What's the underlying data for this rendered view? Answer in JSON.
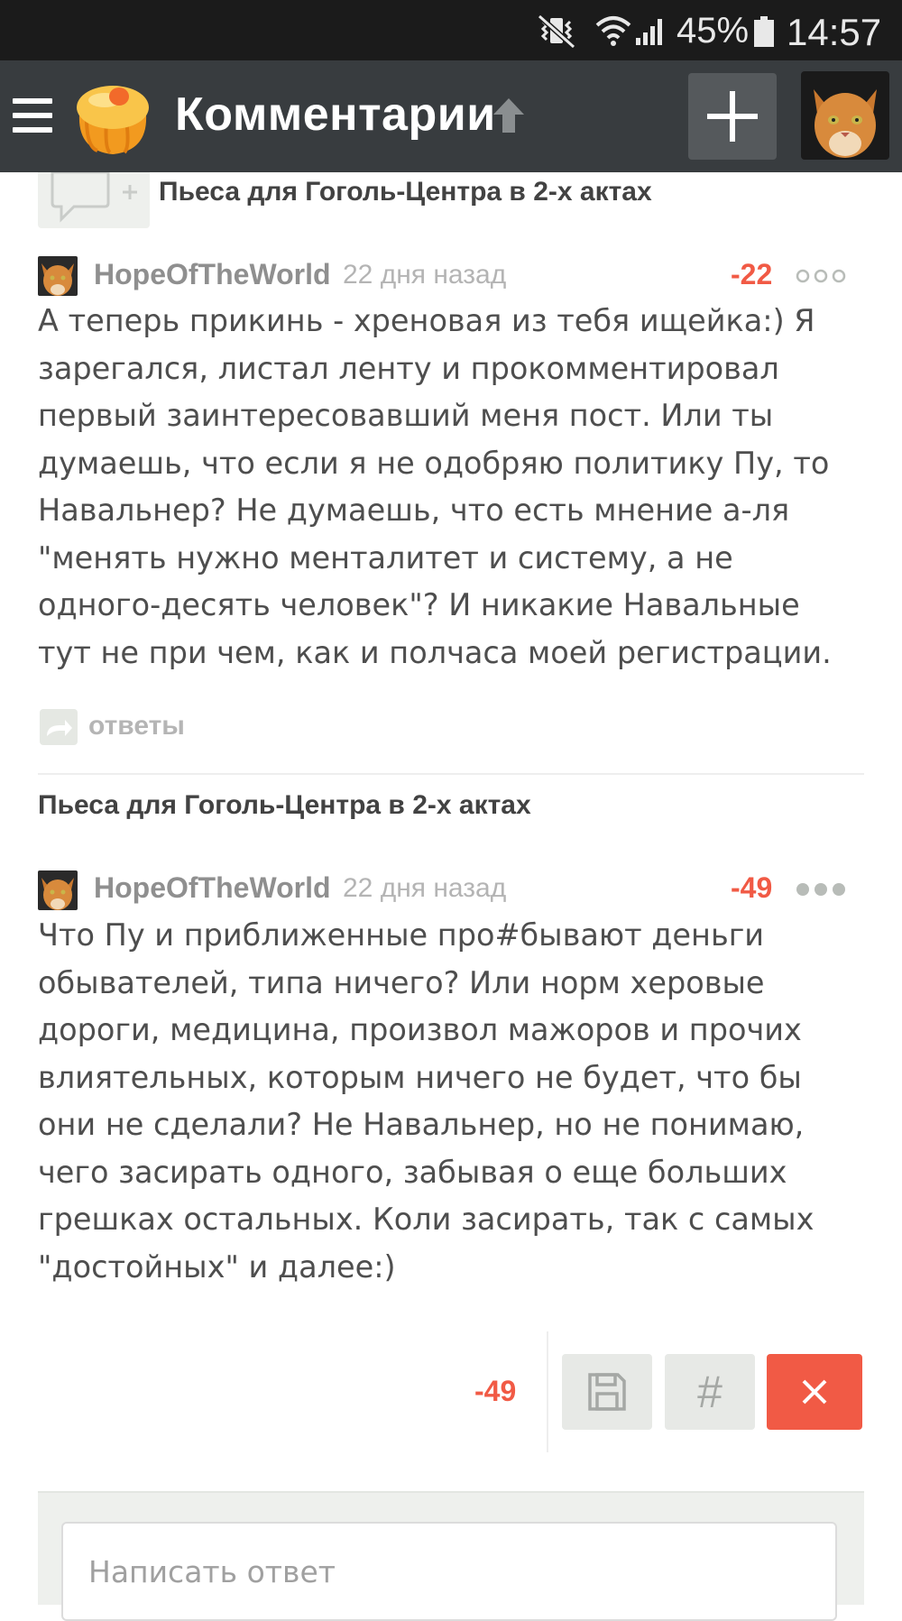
{
  "status_bar": {
    "battery_percent": "45%",
    "time": "14:57",
    "icons": [
      "mute-vibrate-icon",
      "wifi-icon",
      "signal-icon",
      "battery-icon"
    ]
  },
  "toolbar": {
    "title": "Комментарии",
    "icons": [
      "menu-icon",
      "app-logo",
      "scroll-up-arrow-icon",
      "add-icon",
      "user-avatar"
    ]
  },
  "top_post": {
    "title": "Пьеса для Гоголь-Центра в 2-х актах"
  },
  "comment1": {
    "author": "HopeOfTheWorld",
    "time": "22 дня назад",
    "rating": "-22",
    "text": "А теперь прикинь - хреновая из тебя ищейка:) Я\nзарегался, листал ленту и прокомментировал\nпервый заинтересовавший меня пост. Или ты\nдумаешь, что если я не одобряю политику Пу, то\nНавальнер? Не думаешь, что есть мнение а-ля\n\"менять нужно менталитет и систему, а не\nодного-десять человек\"? И никакие Навальные\nтут не при чем, как и полчаса моей регистрации.",
    "replies_label": "ответы"
  },
  "post2": {
    "title": "Пьеса для Гоголь-Центра в 2-х актах"
  },
  "comment2": {
    "author": "HopeOfTheWorld",
    "time": "22 дня назад",
    "rating": "-49",
    "text": "Что Пу и приближенные про#бывают деньги\nобывателей, типа ничего? Или норм херовые\nдороги, медицина, произвол мажоров и прочих\nвлиятельных, которым ничего не будет, что бы\nони не сделали? Не Навальнер, но не понимаю,\nчего засирать одного, забывая о еще больших\nгрешках остальных. Коли засирать, так с самых\n\"достойных\" и далее:)"
  },
  "actions": {
    "rating": "-49",
    "hash_label": "#",
    "colors": {
      "accent_red": "#f15a45",
      "button_gray": "#e7e9e6"
    }
  },
  "reply": {
    "placeholder": "Написать ответ"
  }
}
